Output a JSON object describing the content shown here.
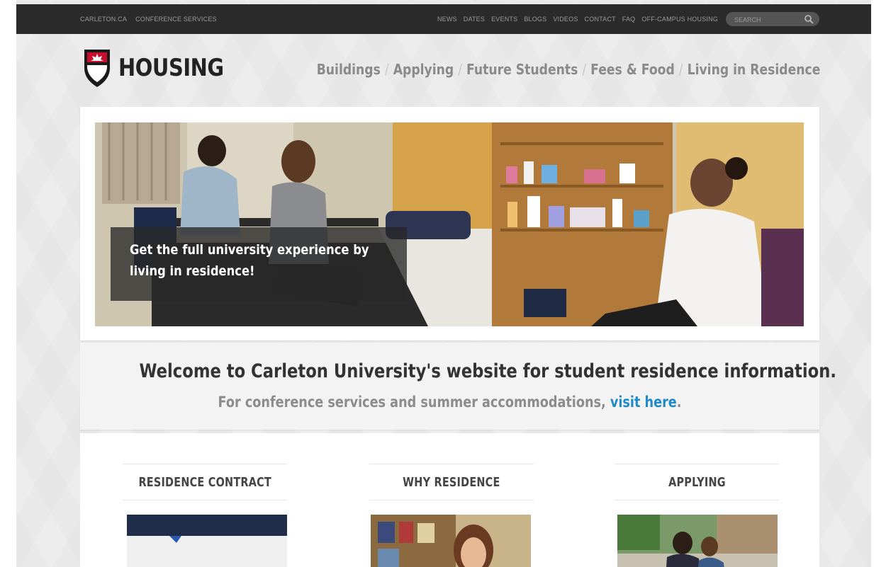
{
  "topbar": {
    "left_links": [
      "CARLETON.CA",
      "CONFERENCE SERVICES"
    ],
    "right_links": [
      "NEWS",
      "DATES",
      "EVENTS",
      "BLOGS",
      "VIDEOS",
      "CONTACT",
      "FAQ",
      "OFF-CAMPUS HOUSING"
    ],
    "search_placeholder": "SEARCH"
  },
  "header": {
    "logo_text": "HOUSING",
    "nav": [
      "Buildings",
      "Applying",
      "Future Students",
      "Fees & Food",
      "Living in Residence"
    ]
  },
  "hero": {
    "caption_line1": "Get the full university experience by",
    "caption_line2": "living in residence!"
  },
  "welcome": {
    "heading": "Welcome to Carleton University's website for student residence information.",
    "sub_text": "For conference services and summer accommodations, ",
    "sub_link": "visit here",
    "sub_end": "."
  },
  "features": [
    {
      "title": "RESIDENCE CONTRACT"
    },
    {
      "title": "WHY RESIDENCE"
    },
    {
      "title": "APPLYING"
    }
  ],
  "colors": {
    "topbar": "#2b2b2b",
    "link_blue": "#1e8ac8",
    "brand_red": "#c8102e"
  }
}
